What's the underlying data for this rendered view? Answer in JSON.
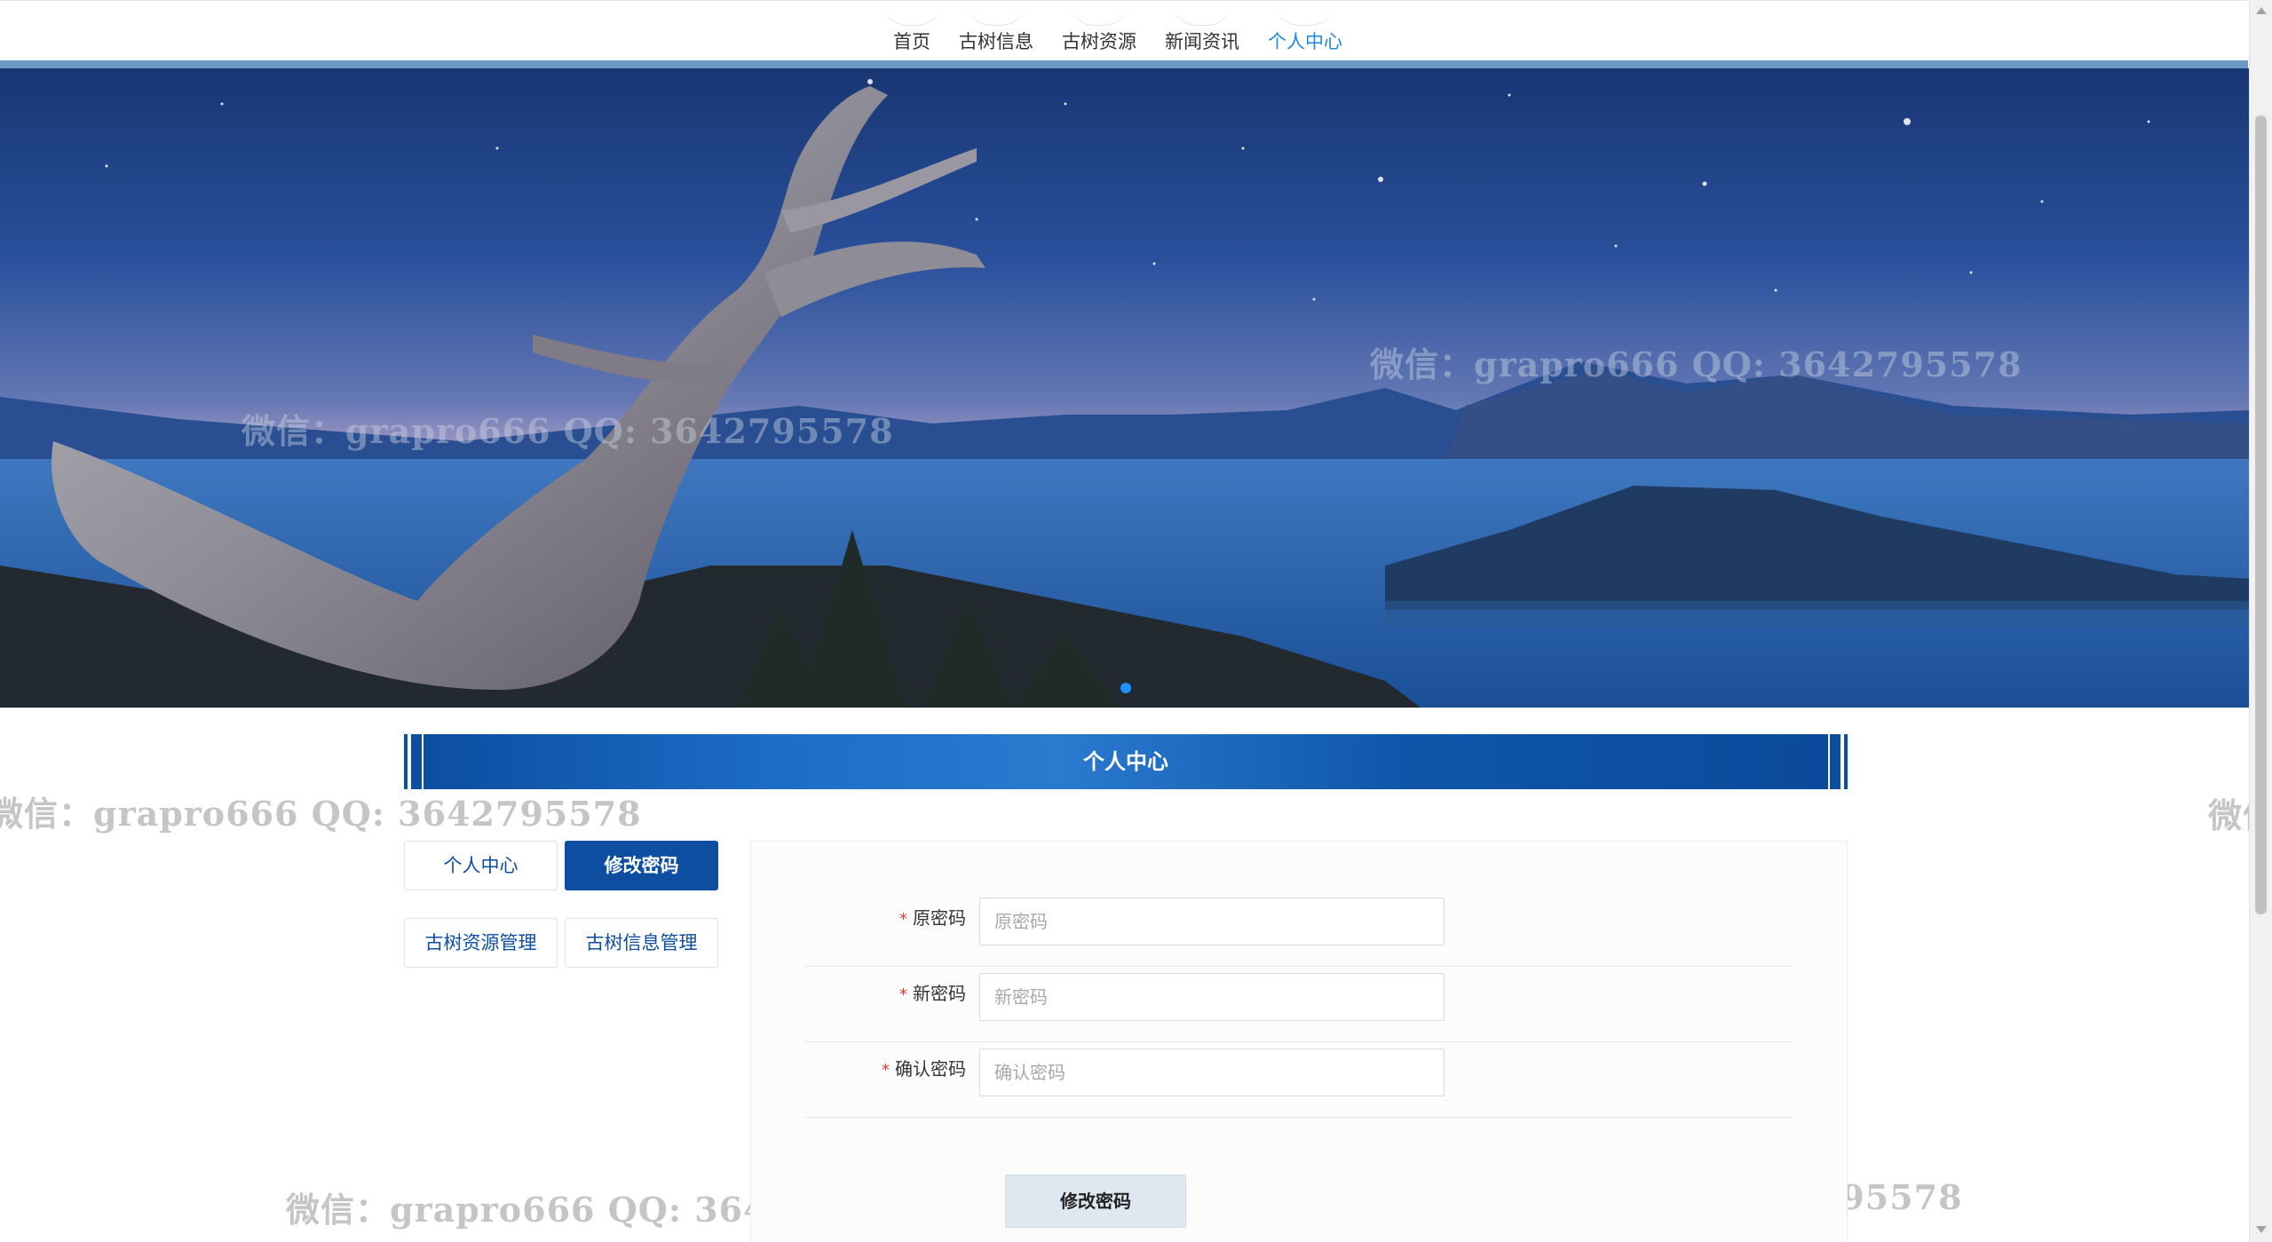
{
  "nav": {
    "items": [
      {
        "label": "首页"
      },
      {
        "label": "古树信息"
      },
      {
        "label": "古树资源"
      },
      {
        "label": "新闻资讯"
      },
      {
        "label": "个人中心",
        "active": true
      }
    ]
  },
  "banner": {
    "image": "night lake landscape with ancient gnarled tree",
    "carousel_active_index": 0
  },
  "section": {
    "title": "个人中心"
  },
  "side_menu": {
    "personal_center": "个人中心",
    "change_password": "修改密码",
    "tree_resource_manage": "古树资源管理",
    "tree_info_manage": "古树信息管理"
  },
  "form": {
    "fields": [
      {
        "label": "原密码",
        "placeholder": "原密码",
        "required": true
      },
      {
        "label": "新密码",
        "placeholder": "新密码",
        "required": true
      },
      {
        "label": "确认密码",
        "placeholder": "确认密码",
        "required": true
      }
    ],
    "required_mark": "*",
    "submit_label": "修改密码"
  },
  "watermark": {
    "text": "微信：grapro666 QQ: 3642795578",
    "edge_fragment": "微信"
  },
  "colors": {
    "accent": "#1e88e5",
    "primary": "#0d4ea0",
    "required": "#e53935",
    "submit_bg": "#dfe7f0"
  }
}
